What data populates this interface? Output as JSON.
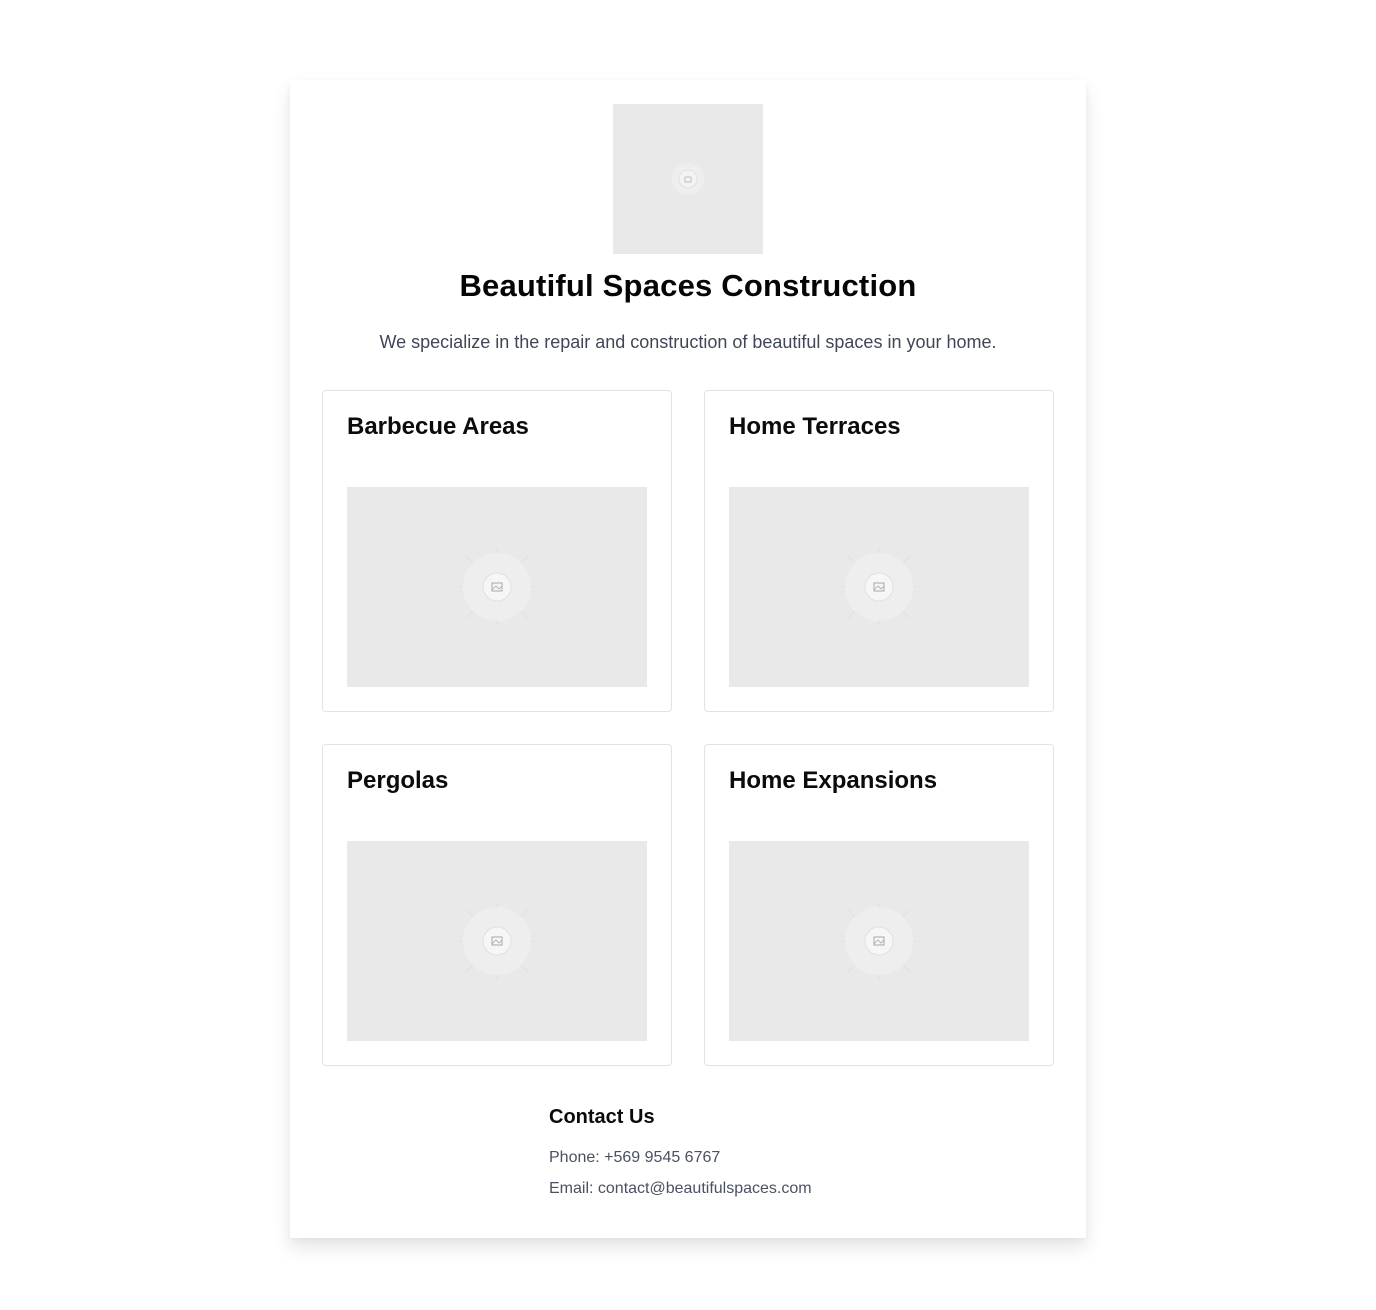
{
  "header": {
    "logo_icon": "image-placeholder-icon",
    "title": "Beautiful Spaces Construction",
    "subtitle": "We specialize in the repair and construction of beautiful spaces in your home."
  },
  "services": [
    {
      "title": "Barbecue Areas",
      "image_icon": "image-placeholder-icon"
    },
    {
      "title": "Home Terraces",
      "image_icon": "image-placeholder-icon"
    },
    {
      "title": "Pergolas",
      "image_icon": "image-placeholder-icon"
    },
    {
      "title": "Home Expansions",
      "image_icon": "image-placeholder-icon"
    }
  ],
  "contact": {
    "title": "Contact Us",
    "phone": "Phone: +569 9545 6767",
    "email": "Email: contact@beautifulspaces.com"
  },
  "colors": {
    "placeholder_bg": "#e9e9e9",
    "card_border": "#e3e3e3",
    "muted_text": "#3f4756"
  }
}
